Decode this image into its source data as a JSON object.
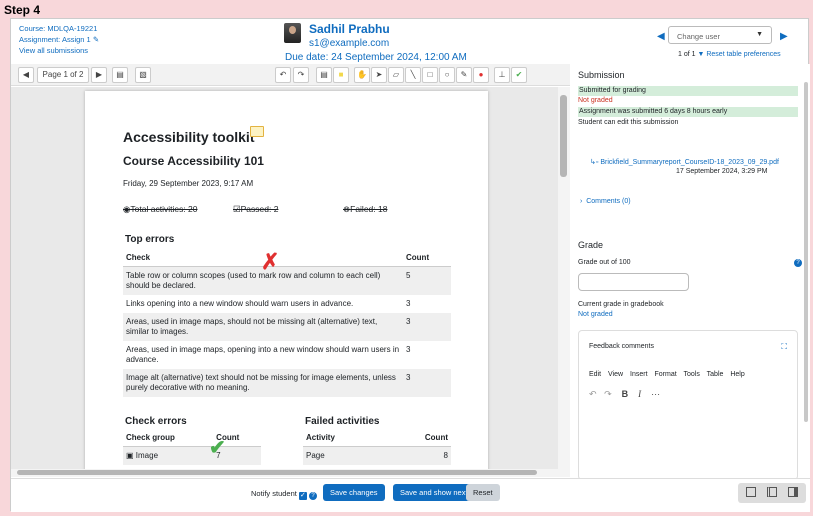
{
  "step": "Step 4",
  "header": {
    "course": "Course: MDLQA-19221",
    "assignment": "Assignment: Assign 1",
    "view_all": "View all submissions",
    "user_name": "Sadhil Prabhu",
    "user_email": "s1@example.com",
    "due_date": "Due date: 24 September 2024, 12:00 AM",
    "change_user_placeholder": "Change user",
    "pager": "1 of 1",
    "reset_prefs": "Reset table preferences"
  },
  "toolbar": {
    "page_label": "Page 1 of 2"
  },
  "doc": {
    "title": "Accessibility toolkit",
    "subtitle": "Course Accessibility 101",
    "date": "Friday, 29 September 2023, 9:17 AM",
    "total": "Total activities: 20",
    "passed": "Passed: 2",
    "failed": "Failed: 18",
    "top_errors_heading": "Top errors",
    "col_check": "Check",
    "col_count": "Count",
    "top_errors": [
      {
        "check": "Table row or column scopes (used to mark row and column to each cell) should be declared.",
        "count": "5"
      },
      {
        "check": "Links opening into a new window should warn users in advance.",
        "count": "3"
      },
      {
        "check": "Areas, used in image maps, should not be missing alt (alternative) text, similar to images.",
        "count": "3"
      },
      {
        "check": "Areas, used in image maps, opening into a new window should warn users in advance.",
        "count": "3"
      },
      {
        "check": "Image alt (alternative) text should not be missing for image elements, unless purely decorative with no meaning.",
        "count": "3"
      }
    ],
    "check_errors_heading": "Check errors",
    "col_group": "Check group",
    "check_row_group": "Image",
    "check_row_count": "7",
    "failed_heading": "Failed activities",
    "col_activity": "Activity",
    "failed_row_activity": "Page",
    "failed_row_count": "8"
  },
  "side": {
    "submission_heading": "Submission",
    "submitted": "Submitted for grading",
    "not_graded": "Not graded",
    "early": "Assignment was submitted 6 days 8 hours early",
    "can_edit": "Student can edit this submission",
    "file": "Brickfield_Summaryreport_CourseID-18_2023_09_29.pdf",
    "file_date": "17 September 2024, 3:29 PM",
    "comments": "Comments (0)",
    "grade_heading": "Grade",
    "grade_out_of": "Grade out of 100",
    "current_grade_label": "Current grade in gradebook",
    "current_grade": "Not graded",
    "feedback": "Feedback comments",
    "menu": [
      "Edit",
      "View",
      "Insert",
      "Format",
      "Tools",
      "Table",
      "Help"
    ]
  },
  "footer": {
    "notify": "Notify student",
    "save": "Save changes",
    "save_next": "Save and show next",
    "reset": "Reset"
  },
  "colors": {
    "accent": "#0f6cbf",
    "success_bg": "#d4edda",
    "danger": "#ca3120",
    "frame_bg": "#f8d7da"
  }
}
